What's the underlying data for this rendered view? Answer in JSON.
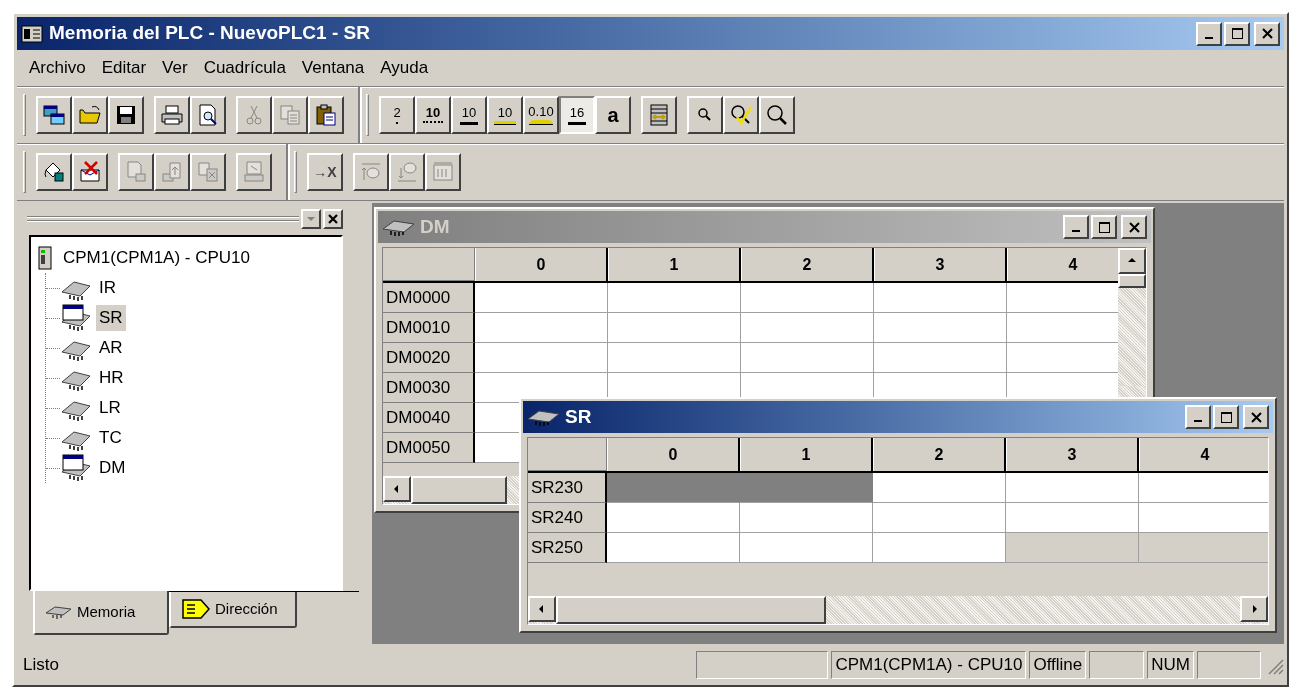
{
  "window": {
    "title": "Memoria del PLC - NuevoPLC1 - SR"
  },
  "menu": [
    "Archivo",
    "Editar",
    "Ver",
    "Cuadrícula",
    "Ventana",
    "Ayuda"
  ],
  "toolbar_rows": [
    {
      "bands": [
        {
          "groups": [
            [
              {
                "disabled": false,
                "pressed": false
              },
              {
                "disabled": false,
                "pressed": false
              },
              {
                "disabled": false,
                "pressed": false
              }
            ],
            [
              {
                "disabled": false,
                "pressed": false
              },
              {
                "disabled": false,
                "pressed": false
              }
            ],
            [
              {
                "disabled": true,
                "pressed": false
              },
              {
                "disabled": true,
                "pressed": false
              },
              {
                "disabled": false,
                "pressed": false
              }
            ]
          ]
        },
        {
          "groups": [
            [
              {
                "label": "2",
                "disabled": false,
                "pressed": false
              },
              {
                "label": "10",
                "disabled": false,
                "pressed": false
              },
              {
                "label": "10",
                "disabled": false,
                "pressed": false
              },
              {
                "label": "10",
                "disabled": false,
                "pressed": false
              },
              {
                "label": "0.10",
                "disabled": false,
                "pressed": false
              },
              {
                "label": "16",
                "disabled": false,
                "pressed": true
              },
              {
                "label": "a",
                "disabled": false,
                "pressed": false
              }
            ],
            [
              {
                "disabled": false,
                "pressed": false
              }
            ],
            [
              {
                "disabled": false,
                "pressed": false
              },
              {
                "disabled": false,
                "pressed": false
              },
              {
                "disabled": false,
                "pressed": false
              }
            ]
          ]
        }
      ]
    },
    {
      "bands": [
        {
          "groups": [
            [
              {
                "disabled": false,
                "pressed": false
              },
              {
                "disabled": false,
                "pressed": false
              }
            ],
            [
              {
                "disabled": true,
                "pressed": false
              },
              {
                "disabled": true,
                "pressed": false
              },
              {
                "disabled": true,
                "pressed": false
              }
            ],
            [
              {
                "disabled": true,
                "pressed": false
              }
            ]
          ]
        },
        {
          "groups": [
            [
              {
                "label": "→X",
                "disabled": false,
                "pressed": false
              }
            ],
            [
              {
                "disabled": true,
                "pressed": false
              },
              {
                "disabled": true,
                "pressed": false
              },
              {
                "disabled": true,
                "pressed": false
              }
            ]
          ]
        }
      ]
    }
  ],
  "side_pane": {
    "tree": {
      "label": "CPM1(CPM1A) - CPU10",
      "children": [
        {
          "label": "IR",
          "open": false,
          "selected": false
        },
        {
          "label": "SR",
          "open": true,
          "selected": true
        },
        {
          "label": "AR",
          "open": false,
          "selected": false
        },
        {
          "label": "HR",
          "open": false,
          "selected": false
        },
        {
          "label": "LR",
          "open": false,
          "selected": false
        },
        {
          "label": "TC",
          "open": false,
          "selected": false
        },
        {
          "label": "DM",
          "open": true,
          "selected": false
        }
      ]
    },
    "tabs": [
      {
        "label": "Memoria",
        "selected": true
      },
      {
        "label": "Dirección",
        "selected": false
      }
    ]
  },
  "child_windows": [
    {
      "title": "DM",
      "active": false,
      "columns": [
        "0",
        "1",
        "2",
        "3",
        "4"
      ],
      "rows": [
        {
          "label": "DM0000"
        },
        {
          "label": "DM0010"
        },
        {
          "label": "DM0020"
        },
        {
          "label": "DM0030"
        },
        {
          "label": "DM0040"
        },
        {
          "label": "DM0050"
        }
      ]
    },
    {
      "title": "SR",
      "active": true,
      "columns": [
        "0",
        "1",
        "2",
        "3",
        "4"
      ],
      "rows": [
        {
          "label": "SR230",
          "cells": [
            {
              "selected": true,
              "disabled": false
            },
            {
              "selected": true,
              "disabled": false
            },
            {
              "selected": false,
              "disabled": false
            },
            {
              "selected": false,
              "disabled": false
            },
            {
              "selected": false,
              "disabled": false
            }
          ]
        },
        {
          "label": "SR240",
          "cells": [
            {
              "selected": false,
              "disabled": false
            },
            {
              "selected": false,
              "disabled": false
            },
            {
              "selected": false,
              "disabled": false
            },
            {
              "selected": false,
              "disabled": false
            },
            {
              "selected": false,
              "disabled": false
            }
          ]
        },
        {
          "label": "SR250",
          "cells": [
            {
              "selected": false,
              "disabled": false
            },
            {
              "selected": false,
              "disabled": false
            },
            {
              "selected": false,
              "disabled": false
            },
            {
              "selected": false,
              "disabled": true
            },
            {
              "selected": false,
              "disabled": true
            }
          ]
        }
      ]
    }
  ],
  "status_bar": {
    "message": "Listo",
    "panels": [
      "CPM1(CPM1A) - CPU10",
      "Offline",
      "NUM"
    ]
  }
}
